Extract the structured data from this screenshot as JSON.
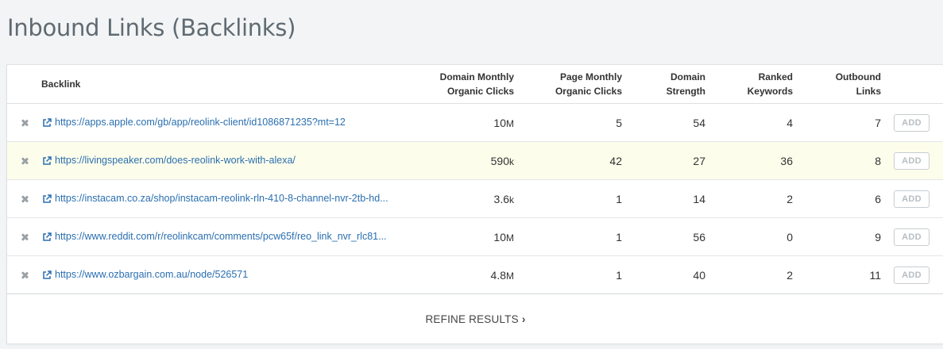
{
  "page": {
    "title": "Inbound Links (Backlinks)"
  },
  "table": {
    "headers": {
      "backlink": "Backlink",
      "domain_clicks_1": "Domain Monthly",
      "domain_clicks_2": "Organic Clicks",
      "page_clicks_1": "Page Monthly",
      "page_clicks_2": "Organic Clicks",
      "domain_strength_1": "Domain",
      "domain_strength_2": "Strength",
      "ranked_keywords_1": "Ranked",
      "ranked_keywords_2": "Keywords",
      "outbound_links_1": "Outbound",
      "outbound_links_2": "Links"
    },
    "rows": [
      {
        "url": "https://apps.apple.com/gb/app/reolink-client/id1086871235?mt=12",
        "domain_clicks": "10",
        "domain_clicks_unit": "M",
        "page_clicks": "5",
        "domain_strength": "54",
        "ranked_keywords": "4",
        "outbound_links": "7",
        "add_label": "ADD"
      },
      {
        "url": "https://livingspeaker.com/does-reolink-work-with-alexa/",
        "domain_clicks": "590",
        "domain_clicks_unit": "k",
        "page_clicks": "42",
        "domain_strength": "27",
        "ranked_keywords": "36",
        "outbound_links": "8",
        "add_label": "ADD"
      },
      {
        "url": "https://instacam.co.za/shop/instacam-reolink-rln-410-8-channel-nvr-2tb-hd...",
        "domain_clicks": "3.6",
        "domain_clicks_unit": "k",
        "page_clicks": "1",
        "domain_strength": "14",
        "ranked_keywords": "2",
        "outbound_links": "6",
        "add_label": "ADD"
      },
      {
        "url": "https://www.reddit.com/r/reolinkcam/comments/pcw65f/reo_link_nvr_rlc81...",
        "domain_clicks": "10",
        "domain_clicks_unit": "M",
        "page_clicks": "1",
        "domain_strength": "56",
        "ranked_keywords": "0",
        "outbound_links": "9",
        "add_label": "ADD"
      },
      {
        "url": "https://www.ozbargain.com.au/node/526571",
        "domain_clicks": "4.8",
        "domain_clicks_unit": "M",
        "page_clicks": "1",
        "domain_strength": "40",
        "ranked_keywords": "2",
        "outbound_links": "11",
        "add_label": "ADD"
      }
    ]
  },
  "footer": {
    "refine_label": "REFINE RESULTS",
    "refine_chevron": "›"
  },
  "colors": {
    "link": "#2a6fb0",
    "highlight_row": "#fdfdeb",
    "remove_icon": "#9aa1a6"
  }
}
